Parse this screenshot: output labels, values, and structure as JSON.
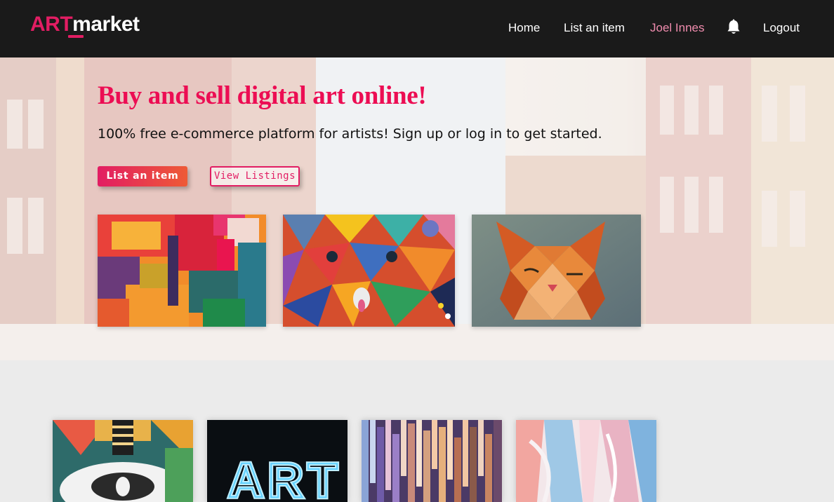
{
  "nav": {
    "logo_part1": "ART",
    "logo_part2": "market",
    "home": "Home",
    "list_item": "List an item",
    "user": "Joel Innes",
    "bell_icon": "bell-icon",
    "logout": "Logout"
  },
  "hero": {
    "title": "Buy and sell digital art online!",
    "subtitle": "100% free e-commerce platform for artists! Sign up or log in to get started.",
    "btn_list": "List an item",
    "btn_view": "View Listings"
  },
  "colors": {
    "brand": "#e21d63",
    "title": "#ec0d53",
    "accent_orange": "#ee5a36",
    "nav_bg": "#1a1a1a",
    "user_link": "#f08cae"
  }
}
